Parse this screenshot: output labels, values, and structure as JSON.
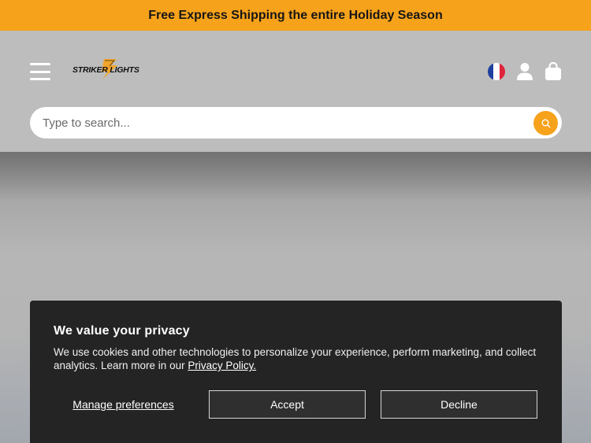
{
  "announcement": {
    "text": "Free Express Shipping the entire Holiday Season"
  },
  "header": {
    "menu_icon": "hamburger-menu-icon",
    "logo": {
      "text": "STRIKER LIGHTS",
      "mark_color": "#f7a21b"
    },
    "flag_icon": "france-flag-icon",
    "account_icon": "user-icon",
    "cart_icon": "shopping-bag-icon"
  },
  "search": {
    "placeholder": "Type to search...",
    "icon": "search-icon",
    "button_color": "#f7a21b"
  },
  "cookie_banner": {
    "title": "We value your privacy",
    "body": "We use cookies and other technologies to personalize your experience, perform marketing, and collect analytics. Learn more in our ",
    "link_text": "Privacy Policy.",
    "manage_label": "Manage preferences",
    "accept_label": "Accept",
    "decline_label": "Decline"
  },
  "colors": {
    "accent": "#f7a21b",
    "banner_bg": "#242424",
    "header_bg": "#bdbdbd"
  }
}
